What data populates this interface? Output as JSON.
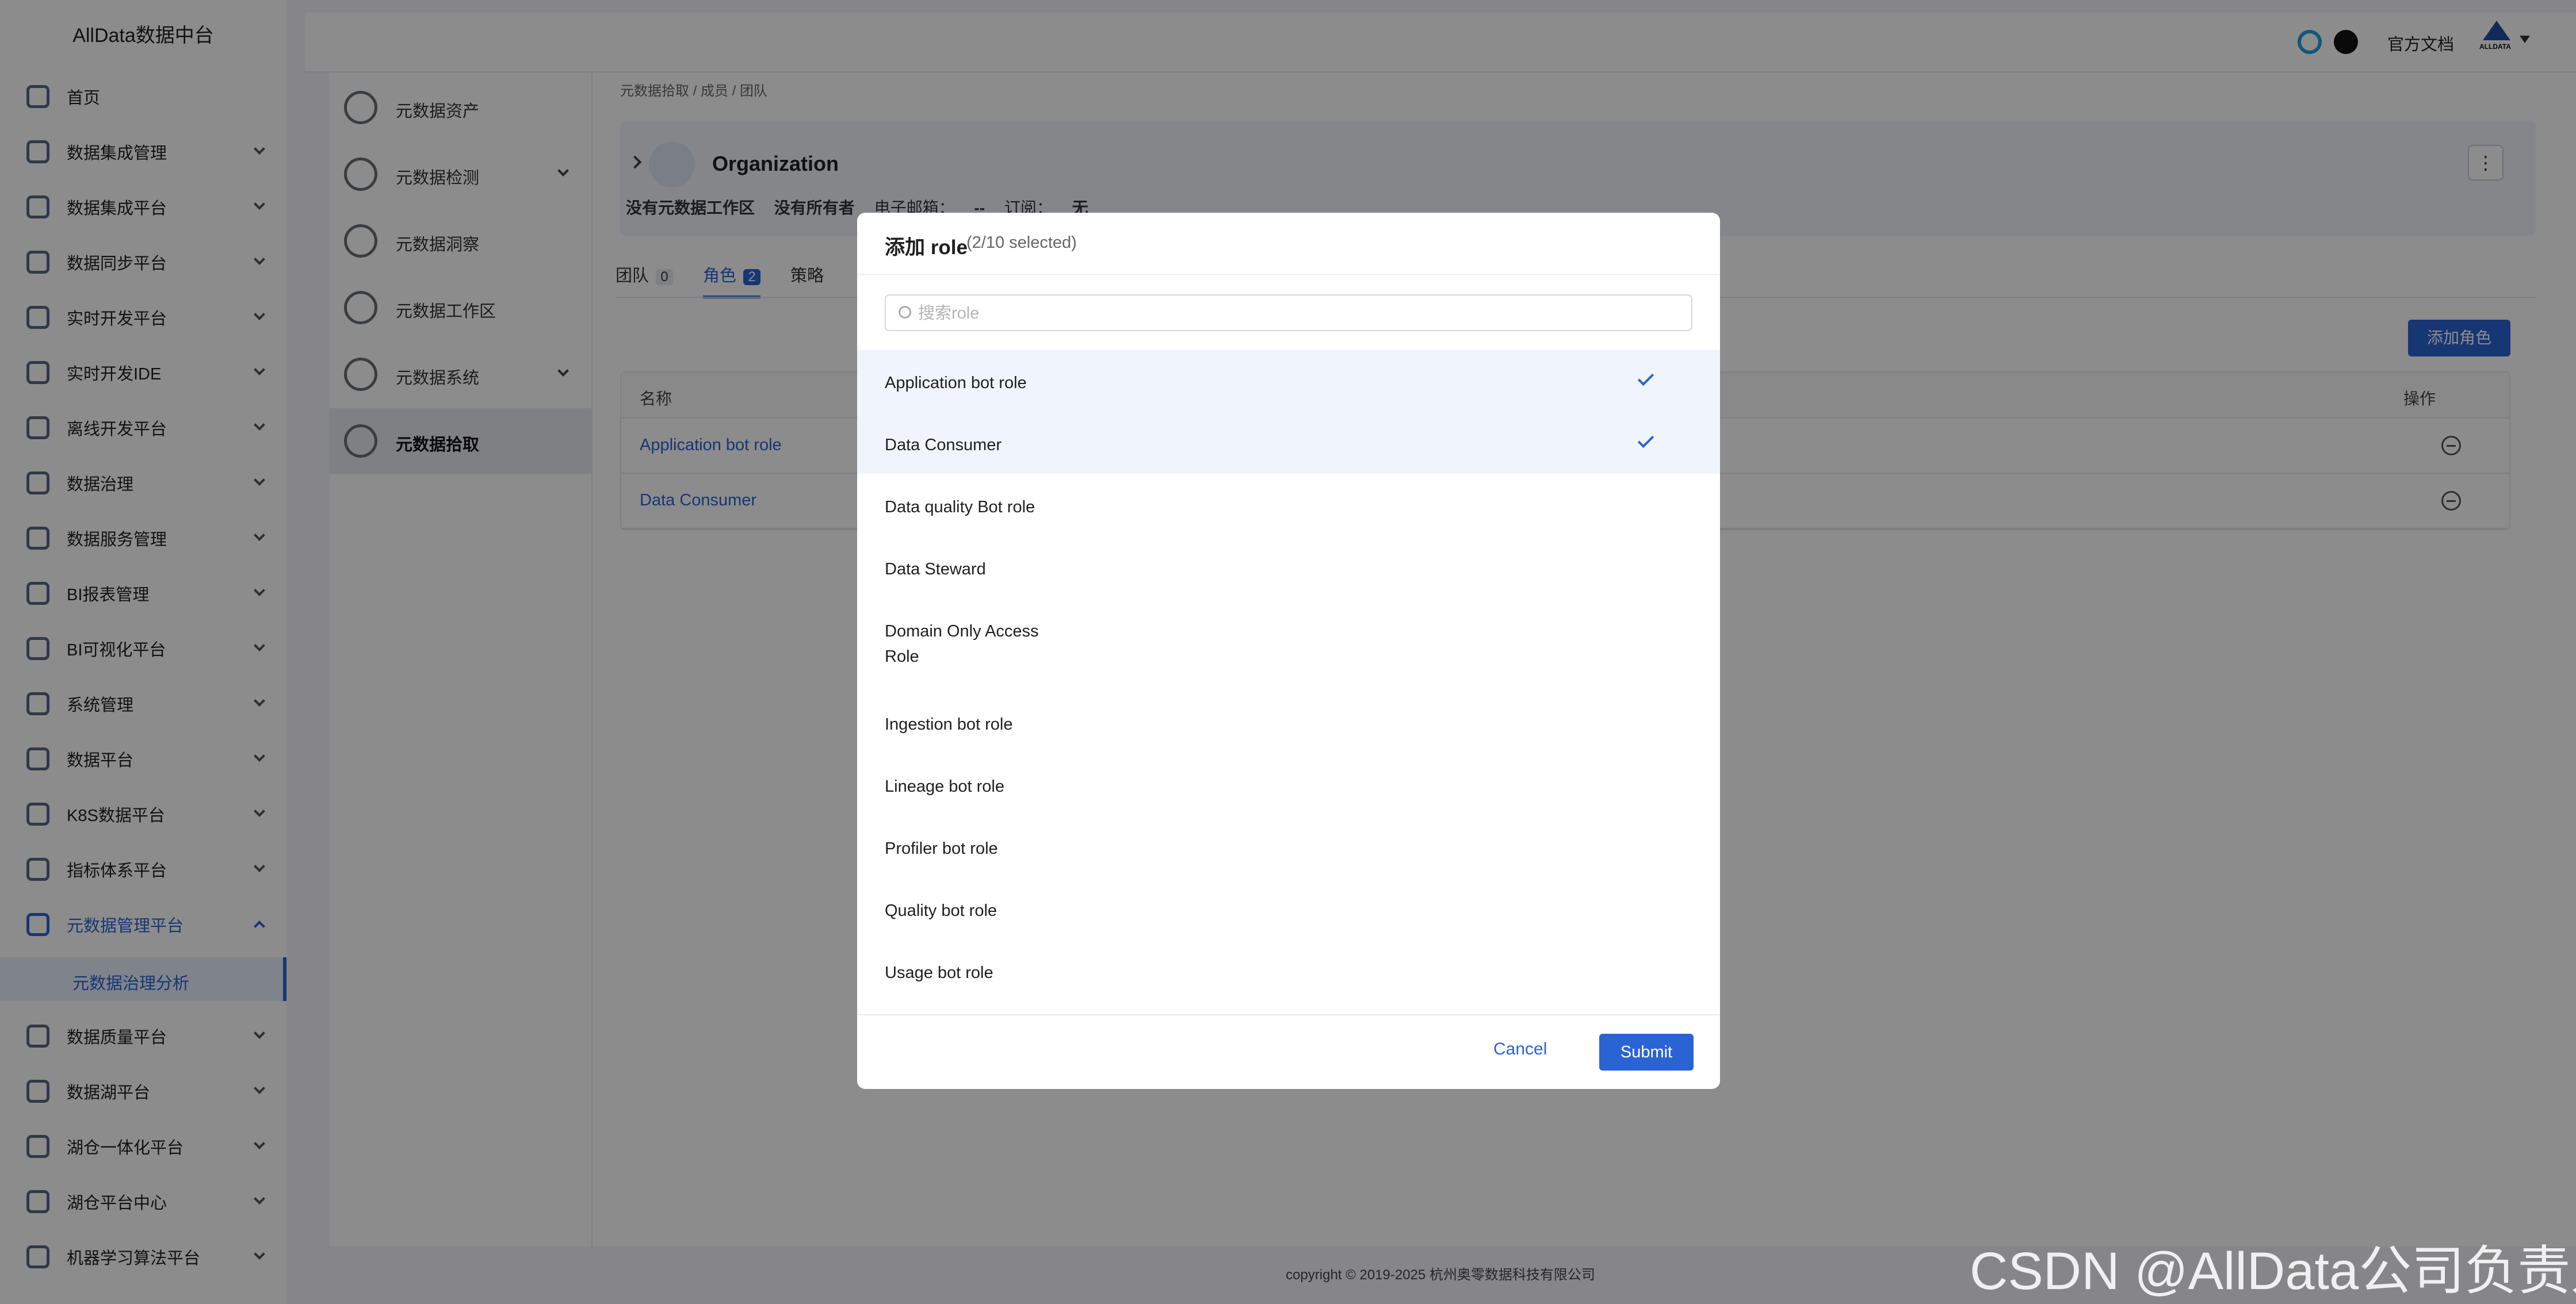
{
  "app": {
    "title": "AllData数据中台"
  },
  "sidebar": {
    "items": [
      {
        "label": "首页",
        "icon": "home-icon",
        "chevron": false
      },
      {
        "label": "数据集成管理",
        "icon": "layers-icon",
        "chevron": true
      },
      {
        "label": "数据集成平台",
        "icon": "database-icon",
        "chevron": true
      },
      {
        "label": "数据同步平台",
        "icon": "sync-icon",
        "chevron": true
      },
      {
        "label": "实时开发平台",
        "icon": "grid-icon",
        "chevron": true
      },
      {
        "label": "实时开发IDE",
        "icon": "ide-icon",
        "chevron": true
      },
      {
        "label": "离线开发平台",
        "icon": "calendar-icon",
        "chevron": true
      },
      {
        "label": "数据治理",
        "icon": "shield-icon",
        "chevron": true
      },
      {
        "label": "数据服务管理",
        "icon": "network-icon",
        "chevron": true
      },
      {
        "label": "BI报表管理",
        "icon": "report-icon",
        "chevron": true
      },
      {
        "label": "BI可视化平台",
        "icon": "monitor-icon",
        "chevron": true
      },
      {
        "label": "系统管理",
        "icon": "gear-icon",
        "chevron": true
      },
      {
        "label": "数据平台",
        "icon": "chart-icon",
        "chevron": true
      },
      {
        "label": "K8S数据平台",
        "icon": "k8s-icon",
        "chevron": true
      },
      {
        "label": "指标体系平台",
        "icon": "cube-icon",
        "chevron": true
      },
      {
        "label": "元数据管理平台",
        "icon": "metadata-icon",
        "chevron": true,
        "active": true
      },
      {
        "label": "数据质量平台",
        "icon": "quality-icon",
        "chevron": true
      },
      {
        "label": "数据湖平台",
        "icon": "lake-icon",
        "chevron": true
      },
      {
        "label": "湖仓一体化平台",
        "icon": "warehouse-icon",
        "chevron": true
      },
      {
        "label": "湖仓平台中心",
        "icon": "center-icon",
        "chevron": true
      },
      {
        "label": "机器学习算法平台",
        "icon": "ml-icon",
        "chevron": true
      }
    ],
    "active_sub_item": "元数据治理分析"
  },
  "header": {
    "docs_label": "官方文档",
    "logo_text": "ALLDATA"
  },
  "secondary_nav": {
    "items": [
      {
        "label": "元数据资产",
        "icon": "globe-search-icon",
        "chevron": false
      },
      {
        "label": "元数据检测",
        "icon": "magnifier-icon",
        "chevron": true
      },
      {
        "label": "元数据洞察",
        "icon": "lightbulb-icon",
        "chevron": false
      },
      {
        "label": "元数据工作区",
        "icon": "globe-icon",
        "chevron": false
      },
      {
        "label": "元数据系统",
        "icon": "bank-icon",
        "chevron": true
      },
      {
        "label": "元数据拾取",
        "icon": "sliders-icon",
        "chevron": false,
        "active": true
      }
    ]
  },
  "main": {
    "breadcrumb": "元数据拾取 / 成员 / 团队",
    "entity": {
      "title": "Organization",
      "domain": "没有元数据工作区",
      "owner": "没有所有者",
      "email_label": "电子邮箱：",
      "email_value": "--",
      "subscription_label": "订阅：",
      "subscription_value": "无"
    },
    "tabs": [
      {
        "label": "团队",
        "count": "0"
      },
      {
        "label": "角色",
        "count": "2",
        "active": true
      },
      {
        "label": "策略",
        "count": ""
      }
    ],
    "add_role_button": "添加角色",
    "table": {
      "headers": {
        "name": "名称",
        "action": "操作"
      },
      "rows": [
        {
          "name": "Application bot role"
        },
        {
          "name": "Data Consumer"
        }
      ]
    }
  },
  "footer": {
    "copyright": "copyright © 2019-2025 杭州奥零数据科技有限公司"
  },
  "modal": {
    "title": "添加 role",
    "selected_text": "(2/10 selected)",
    "search_placeholder": "搜索role",
    "options": [
      {
        "label": "Application bot role",
        "selected": true
      },
      {
        "label": "Data Consumer",
        "selected": true
      },
      {
        "label": "Data quality Bot role",
        "selected": false
      },
      {
        "label": "Data Steward",
        "selected": false
      },
      {
        "label": "Domain Only Access Role",
        "selected": false
      },
      {
        "label": "Ingestion bot role",
        "selected": false
      },
      {
        "label": "Lineage bot role",
        "selected": false
      },
      {
        "label": "Profiler bot role",
        "selected": false
      },
      {
        "label": "Quality bot role",
        "selected": false
      },
      {
        "label": "Usage bot role",
        "selected": false
      }
    ],
    "cancel_label": "Cancel",
    "submit_label": "Submit"
  },
  "watermark": "CSDN @AllData公司负责人",
  "colors": {
    "accent": "#2a63d4",
    "overlay": "rgba(0,0,0,0.45)",
    "selected_row": "#f0f5fd"
  }
}
